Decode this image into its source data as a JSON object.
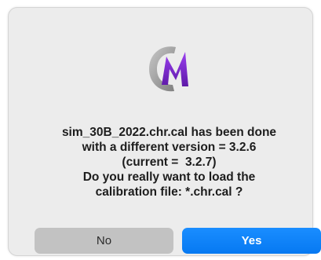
{
  "dialog": {
    "icon": "app-logo-cm-icon",
    "message_lines": [
      "sim_30B_2022.chr.cal has been done",
      "with a different version = 3.2.6",
      "(current =  3.2.7)",
      "Do you really want to load the",
      "calibration file: *.chr.cal ?"
    ],
    "buttons": {
      "no_label": "No",
      "yes_label": "Yes"
    }
  },
  "colors": {
    "dialog_background": "#ececec",
    "primary_button": "#0a84ff",
    "secondary_button": "#c2c2c2",
    "logo_purple": "#7b2ad0",
    "logo_gray": "#9a9a9a"
  }
}
